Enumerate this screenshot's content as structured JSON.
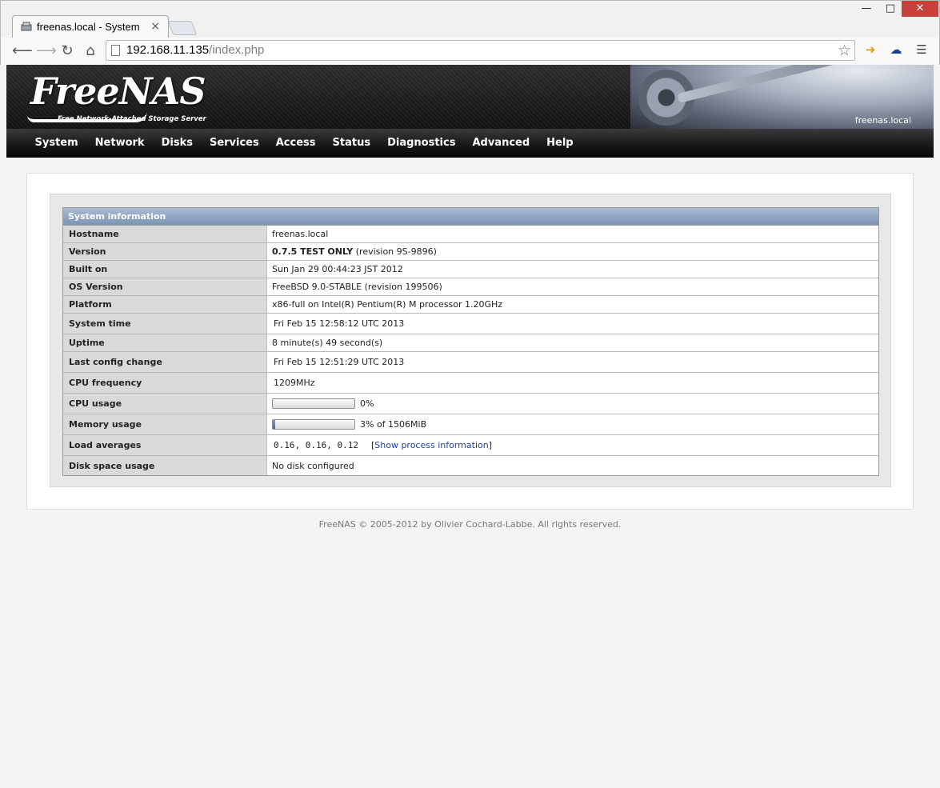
{
  "browser": {
    "tab_title": "freenas.local - System",
    "url_host": "192.168.11.135",
    "url_path": "/index.php",
    "close_tab": "×",
    "win_min": "—",
    "win_max": "□",
    "win_close": "✕"
  },
  "header": {
    "logo": "FreeNAS",
    "tagline": "Free Network-Attached Storage Server",
    "hostname": "freenas.local"
  },
  "menu": [
    "System",
    "Network",
    "Disks",
    "Services",
    "Access",
    "Status",
    "Diagnostics",
    "Advanced",
    "Help"
  ],
  "system_info": {
    "title": "System information",
    "hostname_label": "Hostname",
    "hostname": "freenas.local",
    "version_label": "Version",
    "version_bold": "0.7.5 TEST ONLY",
    "version_rev": "(revision 9S-9896)",
    "built_label": "Built on",
    "built": "Sun Jan 29 00:44:23 JST 2012",
    "os_label": "OS Version",
    "os": "FreeBSD 9.0-STABLE (revision 199506)",
    "platform_label": "Platform",
    "platform": "x86-full on Intel(R) Pentium(R) M processor 1.20GHz",
    "systime_label": "System time",
    "systime": "Fri Feb 15 12:58:12 UTC 2013",
    "uptime_label": "Uptime",
    "uptime": "8 minute(s) 49 second(s)",
    "lastconfig_label": "Last config change",
    "lastconfig": "Fri Feb 15 12:51:29 UTC 2013",
    "cpufreq_label": "CPU frequency",
    "cpufreq": "1209MHz",
    "cpuusage_label": "CPU usage",
    "cpuusage": "0%",
    "cpuusage_fraction": 0.0,
    "memusage_label": "Memory usage",
    "memusage": "3% of 1506MiB",
    "memusage_fraction": 0.03,
    "load_label": "Load averages",
    "load": "0.16, 0.16, 0.12",
    "load_link_open": "[",
    "load_link": "Show process information",
    "load_link_close": "]",
    "disk_label": "Disk space usage",
    "disk": "No disk configured"
  },
  "footer": "FreeNAS © 2005-2012 by Olivier Cochard-Labbe. All rights reserved.",
  "colors": {
    "title_bar": "#8aa1bf",
    "close_button": "#c7403a",
    "link": "#2046a0"
  }
}
